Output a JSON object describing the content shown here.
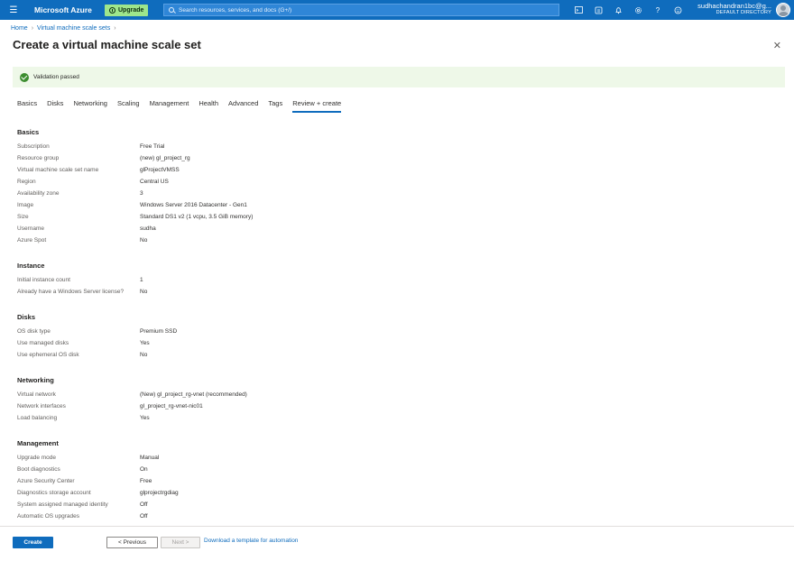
{
  "topbar": {
    "menu_icon": "hamburger-menu-icon",
    "brand": "Microsoft Azure",
    "upgrade_label": "Upgrade",
    "search_placeholder": "Search resources, services, and docs (G+/)",
    "icons": [
      "cloud-shell-icon",
      "directory-filter-icon",
      "notifications-icon",
      "settings-icon",
      "help-icon",
      "feedback-icon"
    ],
    "user_name": "sudhachandran1bc@g...",
    "user_directory": "DEFAULT DIRECTORY"
  },
  "breadcrumb": {
    "home": "Home",
    "parent": "Virtual machine scale sets"
  },
  "page": {
    "title": "Create a virtual machine scale set",
    "close_icon": "close-icon"
  },
  "banner": {
    "text": "Validation passed",
    "status_color": "#3c8d2f"
  },
  "tabs": [
    {
      "label": "Basics"
    },
    {
      "label": "Disks"
    },
    {
      "label": "Networking"
    },
    {
      "label": "Scaling"
    },
    {
      "label": "Management"
    },
    {
      "label": "Health"
    },
    {
      "label": "Advanced"
    },
    {
      "label": "Tags"
    },
    {
      "label": "Review + create",
      "active": true
    }
  ],
  "sections": {
    "basics": {
      "title": "Basics",
      "rows": [
        {
          "k": "Subscription",
          "v": "Free Trial"
        },
        {
          "k": "Resource group",
          "v": "(new) gl_project_rg"
        },
        {
          "k": "Virtual machine scale set name",
          "v": "glProjectVMSS"
        },
        {
          "k": "Region",
          "v": "Central US"
        },
        {
          "k": "Availability zone",
          "v": "3"
        },
        {
          "k": "Image",
          "v": "Windows Server 2016 Datacenter - Gen1"
        },
        {
          "k": "Size",
          "v": "Standard DS1 v2 (1 vcpu, 3.5 GiB memory)"
        },
        {
          "k": "Username",
          "v": "sudha"
        },
        {
          "k": "Azure Spot",
          "v": "No"
        }
      ]
    },
    "instance": {
      "title": "Instance",
      "rows": [
        {
          "k": "Initial instance count",
          "v": "1"
        },
        {
          "k": "Already have a Windows Server license?",
          "v": "No"
        }
      ]
    },
    "disks": {
      "title": "Disks",
      "rows": [
        {
          "k": "OS disk type",
          "v": "Premium SSD"
        },
        {
          "k": "Use managed disks",
          "v": "Yes"
        },
        {
          "k": "Use ephemeral OS disk",
          "v": "No"
        }
      ]
    },
    "networking": {
      "title": "Networking",
      "rows": [
        {
          "k": "Virtual network",
          "v": "(New) gl_project_rg-vnet (recommended)"
        },
        {
          "k": "Network interfaces",
          "v": "gl_project_rg-vnet-nic01"
        },
        {
          "k": "Load balancing",
          "v": "Yes"
        }
      ]
    },
    "management": {
      "title": "Management",
      "rows": [
        {
          "k": "Upgrade mode",
          "v": "Manual"
        },
        {
          "k": "Boot diagnostics",
          "v": "On"
        },
        {
          "k": "Azure Security Center",
          "v": "Free"
        },
        {
          "k": "Diagnostics storage account",
          "v": "glprojectrgdiag"
        },
        {
          "k": "System assigned managed identity",
          "v": "Off"
        },
        {
          "k": "Automatic OS upgrades",
          "v": "Off"
        }
      ]
    }
  },
  "footer": {
    "create_label": "Create",
    "previous_label": "< Previous",
    "next_label": "Next >",
    "download_link": "Download a template for automation"
  },
  "colors": {
    "accent": "#0f6cbd",
    "success_bg": "#eef8e8",
    "upgrade_bg": "#9ee68c"
  }
}
